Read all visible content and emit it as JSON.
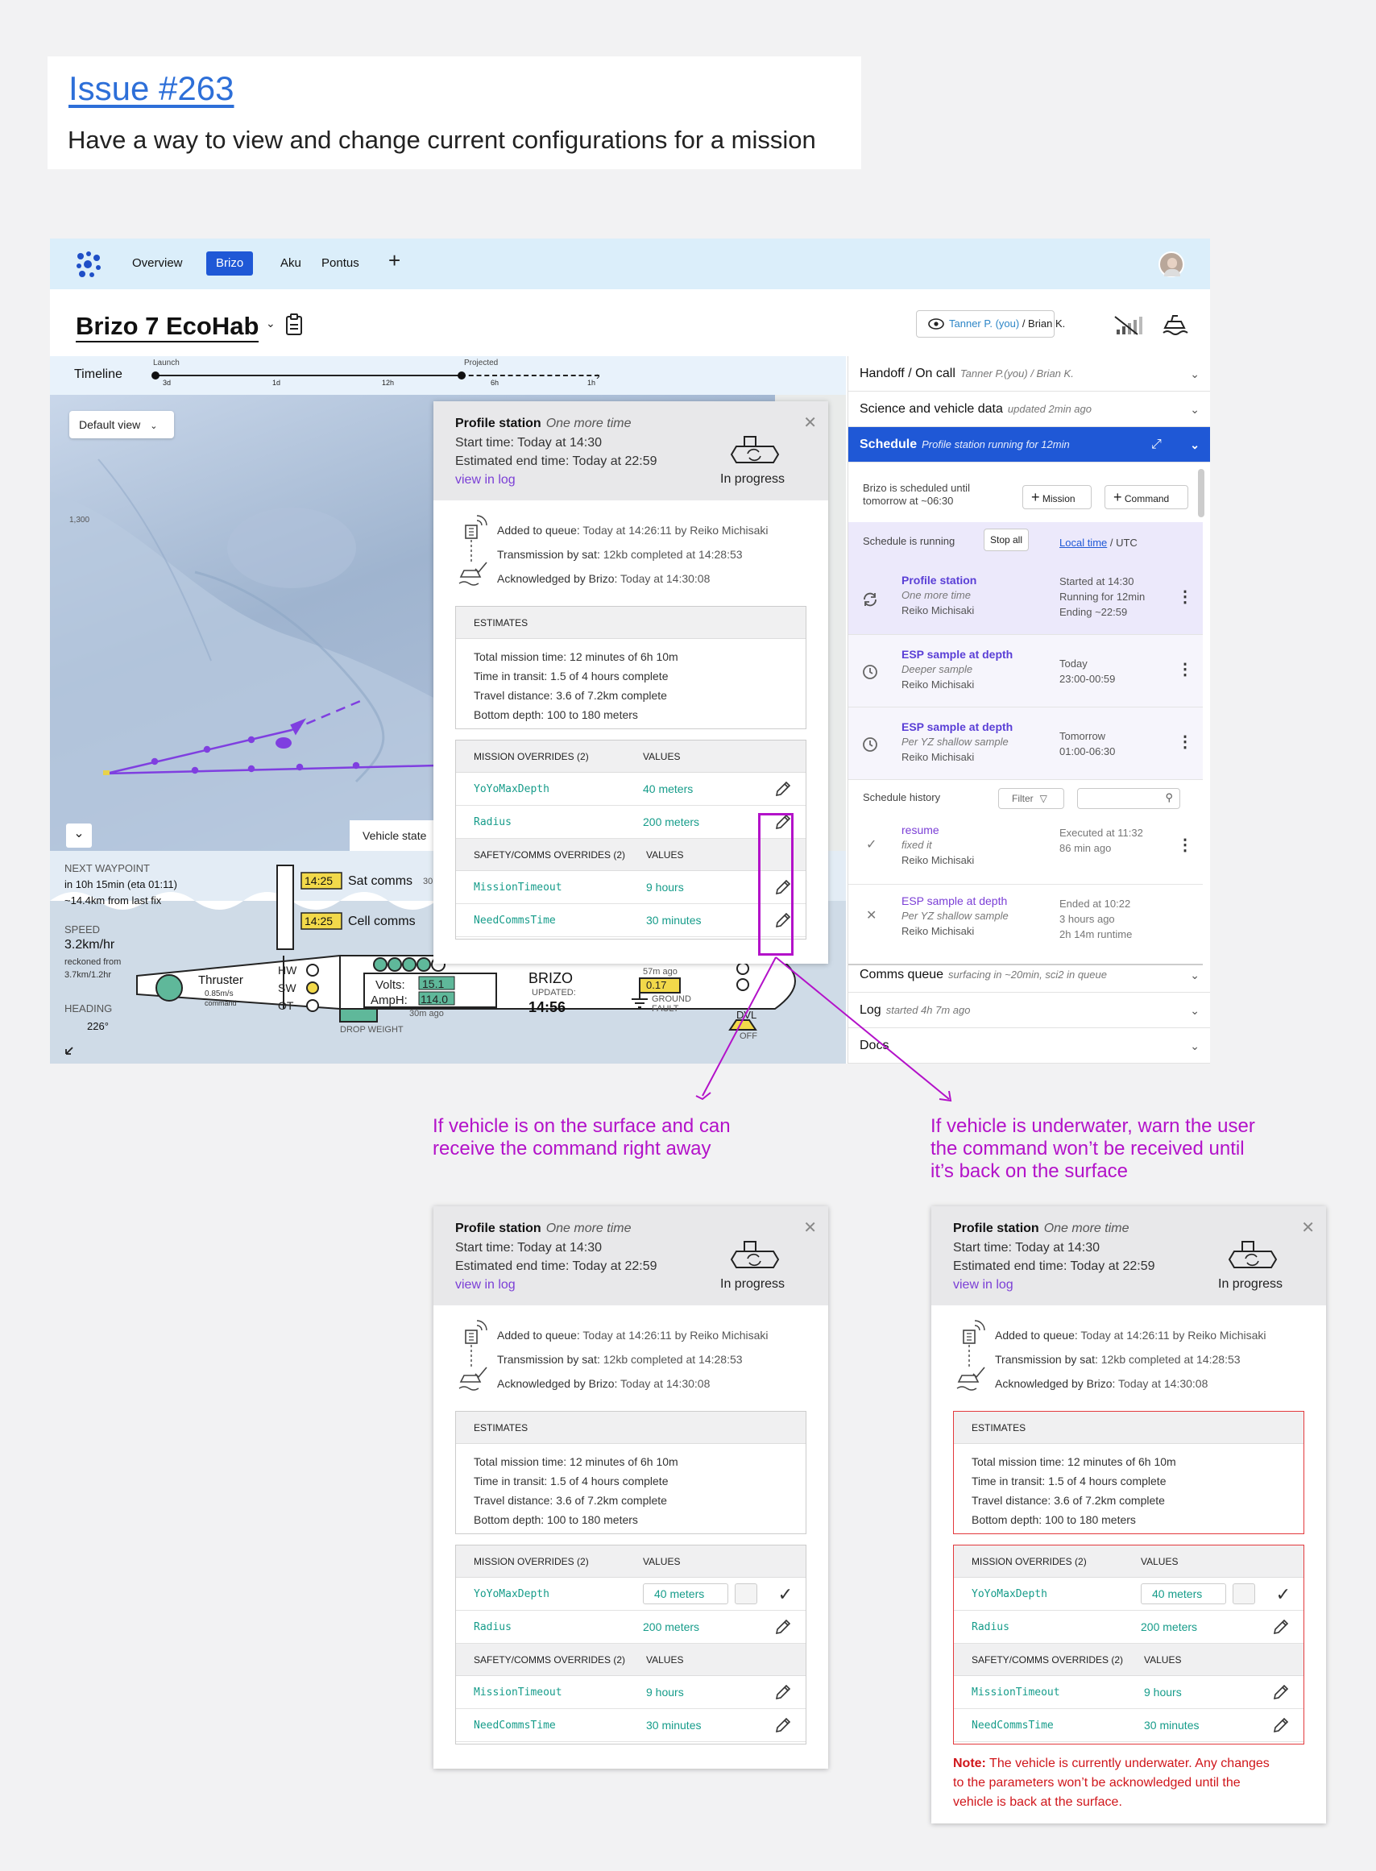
{
  "issue": {
    "title": "Issue #263",
    "description": "Have a way to view and change current configurations for a mission"
  },
  "nav": {
    "tabs": [
      "Overview",
      "Brizo",
      "Aku",
      "Pontus"
    ],
    "active": "Brizo",
    "add": "+"
  },
  "mission": {
    "title": "Brizo 7 EcoHab",
    "watchers_you": "Tanner P. (you)",
    "watchers_sep": " / ",
    "watchers_other": "Brian K."
  },
  "timeline": {
    "label": "Timeline",
    "launch": "Launch",
    "projected": "Projected",
    "ticks": [
      "3d",
      "1d",
      "12h",
      "6h",
      "1h"
    ]
  },
  "map": {
    "default_view": "Default view",
    "depth_label": "1,300",
    "vehicle_state_tab": "Vehicle state"
  },
  "vehicle": {
    "next_waypoint_label": "NEXT WAYPOINT",
    "next_waypoint_eta": "in 10h 15min (eta 01:11)",
    "next_waypoint_dist": "~14.4km from last fix",
    "speed_label": "SPEED",
    "speed_value": "3.2km/hr",
    "speed_note1": "reckoned from",
    "speed_note2": "3.7km/1.2hr",
    "heading_label": "HEADING",
    "heading_value": "226°",
    "sat_time": "14:25",
    "sat_label": "Sat comms",
    "sat_extra": "30",
    "cell_time": "14:25",
    "cell_label": "Cell comms",
    "thruster": "Thruster",
    "thruster_speed": "0.85m/s",
    "thruster_cmd": "command",
    "hw": "HW",
    "sw": "SW",
    "ot": "OT",
    "volts_label": "Volts:",
    "volts": "15.1",
    "amph_label": "AmpH:",
    "amph": "114.0",
    "battery_age": "30m ago",
    "name": "BRIZO",
    "updated_label": "UPDATED:",
    "updated_time": "14:56",
    "fault_age": "57m ago",
    "fault_value": "0.17",
    "fault_label1": "GROUND",
    "fault_label2": "FAULT",
    "dvl": "DVL",
    "dvl_state": "OFF",
    "drop_weight": "DROP WEIGHT"
  },
  "right_panel": {
    "handoff": {
      "label": "Handoff / On call",
      "sub": "Tanner P.(you) / Brian K."
    },
    "science": {
      "label": "Science and vehicle data",
      "sub": "updated 2min ago"
    },
    "schedule": {
      "label": "Schedule",
      "sub": "Profile station running for 12min"
    },
    "scheduled_until1": "Brizo is scheduled until",
    "scheduled_until2": "tomorrow at ~06:30",
    "btn_mission": "Mission",
    "btn_command": "Command",
    "running": "Schedule is running",
    "stop_all": "Stop all",
    "local_time": "Local time",
    "utc": " / UTC",
    "items": [
      {
        "title": "Profile station",
        "sub": "One more time",
        "who": "Reiko Michisaki",
        "r1": "Started at 14:30",
        "r2": "Running for 12min",
        "r3": "Ending ~22:59"
      },
      {
        "title": "ESP sample at depth",
        "sub": "Deeper sample",
        "who": "Reiko Michisaki",
        "r1": "Today",
        "r2": "23:00-00:59"
      },
      {
        "title": "ESP sample at depth",
        "sub": "Per YZ shallow sample",
        "who": "Reiko Michisaki",
        "r1": "Tomorrow",
        "r2": "01:00-06:30"
      }
    ],
    "history_label": "Schedule history",
    "filter": "Filter",
    "history": [
      {
        "title": "resume",
        "sub": "fixed it",
        "who": "Reiko Michisaki",
        "r1": "Executed at 11:32",
        "r2": "86 min ago"
      },
      {
        "title": "ESP sample at depth",
        "sub": "Per YZ shallow sample",
        "who": "Reiko Michisaki",
        "r1": "Ended at 10:22",
        "r2": "3 hours ago",
        "r3": "2h 14m runtime"
      }
    ],
    "comms": {
      "label": "Comms queue",
      "sub": "surfacing in ~20min, sci2 in queue"
    },
    "log": {
      "label": "Log",
      "sub": "started 4h 7m ago"
    },
    "docs": {
      "label": "Docs"
    }
  },
  "profile": {
    "title": "Profile station",
    "subtitle": "One more time",
    "start": "Start time: Today at 14:30",
    "end": "Estimated end time: Today at 22:59",
    "view_log": "view in log",
    "status": "In progress",
    "queue": [
      {
        "label": "Added to queue:",
        "value": " Today at 14:26:11 by Reiko Michisaki"
      },
      {
        "label": "Transmission by sat:",
        "value": " 12kb completed at 14:28:53"
      },
      {
        "label": "Acknowledged by Brizo:",
        "value": " Today at 14:30:08"
      }
    ],
    "estimates_label": "ESTIMATES",
    "estimates": [
      {
        "label": "Total mission time:",
        "value": "  12 minutes of 6h 10m"
      },
      {
        "label": "Time in transit:",
        "value": "  1.5 of 4 hours complete"
      },
      {
        "label": "Travel distance:",
        "value": " 3.6 of 7.2km complete"
      },
      {
        "label": "Bottom depth:",
        "value": " 100 to 180 meters"
      }
    ],
    "mission_overrides_label": "MISSION OVERRIDES (2)",
    "safety_overrides_label": "SAFETY/COMMS OVERRIDES (2)",
    "values_label": "VALUES",
    "mission_overrides": [
      {
        "key": "YoYoMaxDepth",
        "value": "40 meters"
      },
      {
        "key": "Radius",
        "value": "200 meters"
      }
    ],
    "safety_overrides": [
      {
        "key": "MissionTimeout",
        "value": "9 hours"
      },
      {
        "key": "NeedCommsTime",
        "value": "30 minutes"
      }
    ]
  },
  "annotations": {
    "surface1": "If vehicle is on the surface and can",
    "surface2": "receive the command right away",
    "under1": "If vehicle is underwater, warn the user",
    "under2": "the command won’t be received until",
    "under3": "it’s back on the surface"
  },
  "warning": {
    "prefix": "Note:",
    "text1": " The vehicle is currently underwater. Any changes",
    "text2": "to the parameters won’t be acknowledged until the",
    "text3": "vehicle is back at the surface."
  },
  "colors": {
    "accent": "#1f58d6",
    "purple": "#7b3fd6",
    "teal": "#169c8a",
    "annotation": "#b312c9",
    "warning": "#d0161b"
  }
}
